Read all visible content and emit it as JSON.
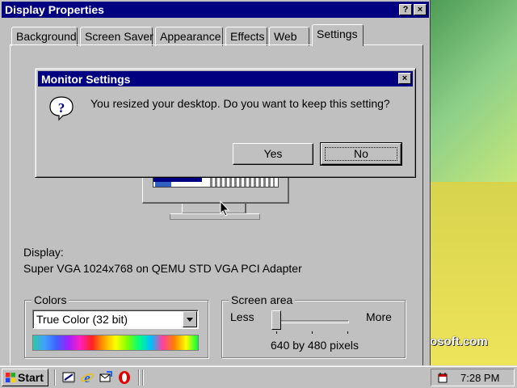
{
  "window": {
    "title": "Display Properties",
    "help_btn": "?",
    "close_btn": "×"
  },
  "tabs": [
    {
      "label": "Background"
    },
    {
      "label": "Screen Saver"
    },
    {
      "label": "Appearance"
    },
    {
      "label": "Effects"
    },
    {
      "label": "Web"
    },
    {
      "label": "Settings"
    }
  ],
  "active_tab": "Settings",
  "display": {
    "label": "Display:",
    "value": "Super VGA 1024x768 on QEMU STD VGA PCI Adapter"
  },
  "colors": {
    "group_label": "Colors",
    "selected": "True Color (32 bit)"
  },
  "screen_area": {
    "group_label": "Screen area",
    "less_label": "Less",
    "more_label": "More",
    "value_text": "640 by 480 pixels",
    "slider_position": 0
  },
  "dialog": {
    "title": "Monitor Settings",
    "close_btn": "×",
    "message": "You resized your desktop.  Do you want to keep this setting?",
    "yes_label": "Yes",
    "no_label": "No",
    "icon": "question-icon"
  },
  "desktop": {
    "brand_text": "osoft.com"
  },
  "taskbar": {
    "start_label": "Start",
    "clock": "7:28 PM",
    "quick_launch": [
      "show-desktop-icon",
      "internet-explorer-icon",
      "outlook-express-icon",
      "opera-icon"
    ]
  },
  "colors_theme": {
    "titlebar": "#000080",
    "face": "#c0c0c0"
  }
}
